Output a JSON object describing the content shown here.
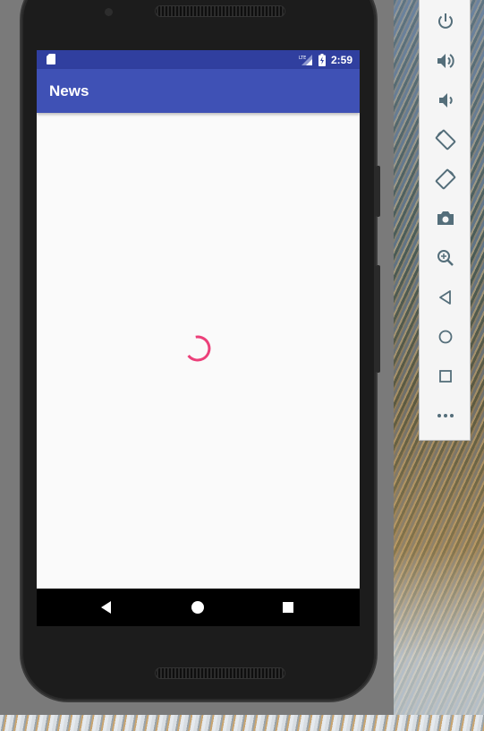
{
  "status_bar": {
    "time": "2:59",
    "network": "LTE"
  },
  "app": {
    "title": "News",
    "loading": true
  },
  "colors": {
    "primary": "#3f51b5",
    "primary_dark": "#303f9f",
    "accent": "#ec407a",
    "background": "#fafafa"
  },
  "nav_bar": {
    "buttons": [
      "back",
      "home",
      "recents"
    ]
  },
  "emulator_toolbar": {
    "tools": [
      "power-icon",
      "volume-up-icon",
      "volume-down-icon",
      "rotate-left-icon",
      "rotate-right-icon",
      "camera-icon",
      "zoom-icon",
      "back-icon",
      "home-icon",
      "overview-icon",
      "more-icon"
    ]
  }
}
